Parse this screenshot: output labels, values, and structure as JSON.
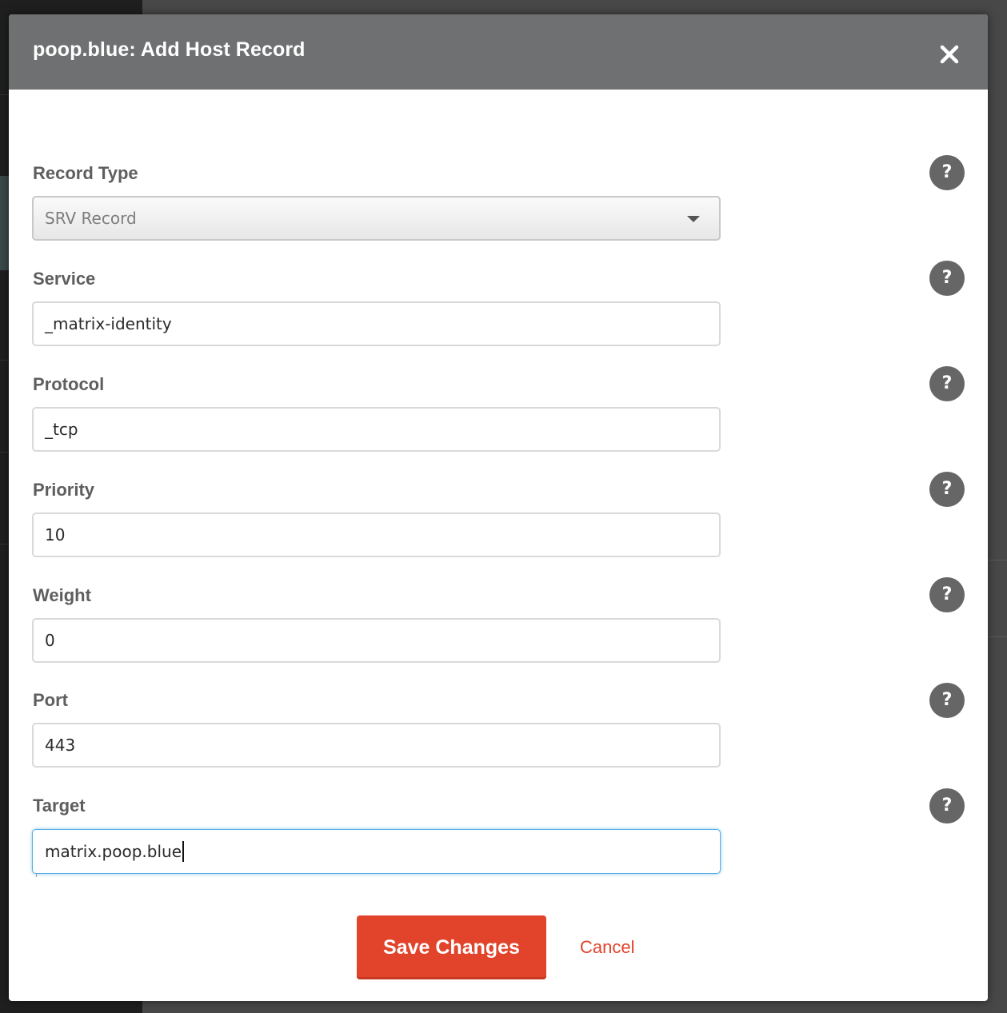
{
  "modal": {
    "title": "poop.blue: Add Host Record",
    "close_icon": "close-icon"
  },
  "form": {
    "record_type": {
      "label": "Record Type",
      "value": "SRV Record"
    },
    "service": {
      "label": "Service",
      "value": "_matrix-identity"
    },
    "protocol": {
      "label": "Protocol",
      "value": "_tcp"
    },
    "priority": {
      "label": "Priority",
      "value": "10"
    },
    "weight": {
      "label": "Weight",
      "value": "0"
    },
    "port": {
      "label": "Port",
      "value": "443"
    },
    "target": {
      "label": "Target",
      "value": "matrix.poop.blue"
    },
    "help_icon_glyph": "?"
  },
  "actions": {
    "save_label": "Save Changes",
    "cancel_label": "Cancel"
  },
  "colors": {
    "header_bg": "#6f7072",
    "accent": "#e2432b",
    "focus_border": "#5aaee8"
  }
}
